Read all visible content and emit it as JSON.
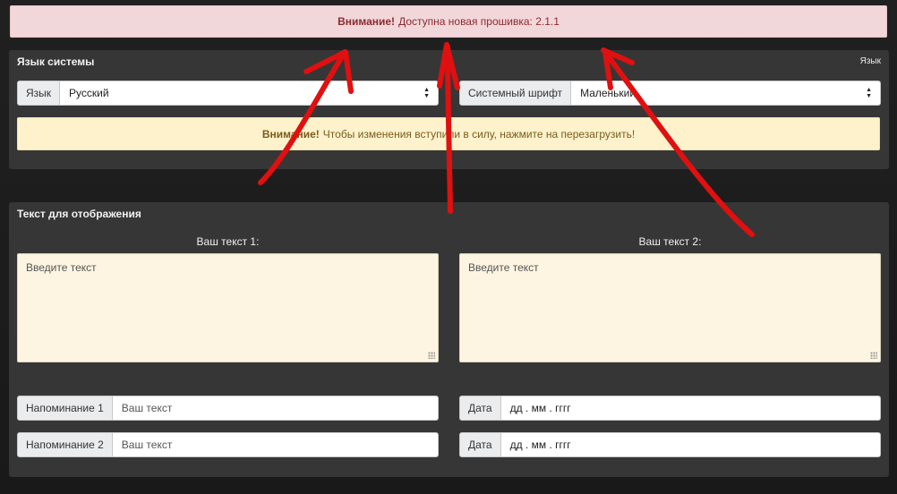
{
  "firmware_alert": {
    "strong": "Внимание!",
    "text": "Доступна новая прошивка: 2.1.1"
  },
  "language_panel": {
    "title": "Язык системы",
    "right_label": "Язык",
    "language": {
      "label": "Язык",
      "value": "Русский"
    },
    "font": {
      "label": "Системный шрифт",
      "value": "Маленький"
    },
    "warning": {
      "strong": "Внимание!",
      "text": "Чтобы изменения вступили в силу, нажмите на перезагрузить!"
    }
  },
  "text_panel": {
    "title": "Текст для отображения",
    "text1": {
      "label": "Ваш текст 1:",
      "placeholder": "Введите текст"
    },
    "text2": {
      "label": "Ваш текст 2:",
      "placeholder": "Введите текст"
    },
    "reminder1": {
      "label": "Напоминание 1",
      "placeholder": "Ваш текст"
    },
    "reminder2": {
      "label": "Напоминание 2",
      "placeholder": "Ваш текст"
    },
    "date1": {
      "label": "Дата",
      "placeholder": "дд . мм . гггг"
    },
    "date2": {
      "label": "Дата",
      "placeholder": "дд . мм . гггг"
    }
  },
  "colors": {
    "annotation_arrows": "#e01010",
    "danger_bg": "#f2d7da",
    "warning_bg": "#fdf2cc",
    "panel_bg": "#363636"
  }
}
